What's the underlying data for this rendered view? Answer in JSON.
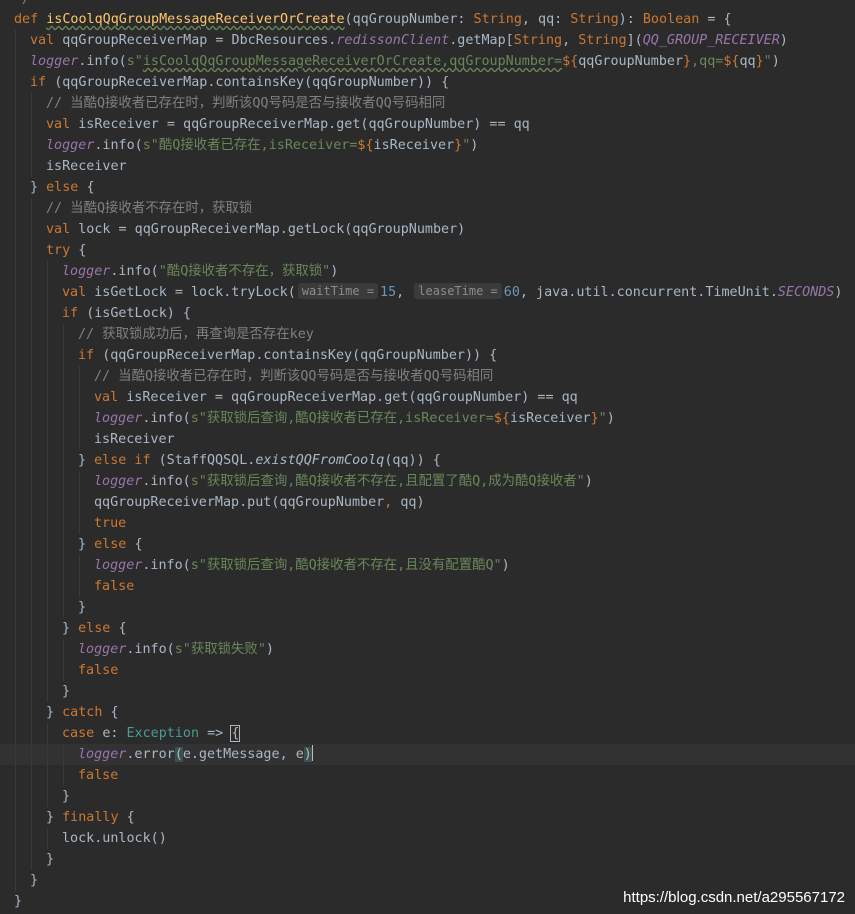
{
  "watermark": "https://blog.csdn.net/a295567172",
  "hints": {
    "waitTime": "waitTime =",
    "leaseTime": "leaseTime ="
  },
  "code": {
    "l1a": "def ",
    "l1b": "isCoolqQqGroupMessageReceiverOrCreate",
    "l1c": "(qqGroupNumber: ",
    "l1d": "String",
    ", ": "",
    "l1e": ", qq: ",
    "l1f": "String",
    "l1g": "): ",
    "l1h": "Boolean",
    "l1i": " = {",
    "l2a": "val ",
    "l2b": "qqGroupReceiverMap = DbcResources.",
    "l2c": "redissonClient",
    ".getMap": "",
    "l2d": ".getMap[",
    "l2e": "String",
    ", String": "",
    "l2f": ", ",
    "l2g": "String",
    "l2h": "](",
    "l2i": "QQ_GROUP_RECEIVER",
    "l2j": ")",
    "l3a": "logger",
    ".info": "",
    "l3b": ".info(",
    "l3c": "s\"",
    "l3d": "isCoolqQqGroupMessageReceiverOrCreate,qqGroupNumber=",
    "l3e": "${",
    "l3f": "qqGroupNumber",
    "l3g": "}",
    ",qq=": "",
    "l3h": ",qq=",
    "l3i": "${",
    "l3j": "qq",
    "l3k": "}",
    "l3l": "\"",
    ")": "",
    "l3m": ")",
    "l4a": "if ",
    "l4b": "(qqGroupReceiverMap.containsKey(qqGroupNumber)) {",
    "l5": "// 当酷Q接收者已存在时，判断该QQ号码是否与接收者QQ号码相同",
    "l6a": "val ",
    "l6b": "isReceiver = qqGroupReceiverMap.get(qqGroupNumber) == qq",
    "l7a": "logger",
    "l7b": ".info(",
    "l7c": "s\"酷Q接收者已存在,isReceiver=",
    "l7d": "${",
    "l7e": "isReceiver",
    "l7f": "}",
    "l7g": "\"",
    "l7h": ")",
    "l8": "isReceiver",
    "l9a": "} ",
    "l9b": "else ",
    "l9c": "{",
    "l10": "// 当酷Q接收者不存在时，获取锁",
    "l11a": "val ",
    "l11b": "lock = qqGroupReceiverMap.getLock(qqGroupNumber)",
    "l12a": "try ",
    "l12b": "{",
    "l13a": "logger",
    "l13b": ".info(",
    "l13c": "\"酷Q接收者不存在，获取锁\"",
    "l13d": ")",
    "l14a": "val ",
    "l14b": "isGetLock = lock.tryLock(",
    "l14c": "15",
    "l14d": ", ",
    "l14e": "60",
    ", java": "",
    "l14f": ", java.util.concurrent.TimeUnit.",
    "l14g": "SECONDS",
    "l14h": ")",
    "l15a": "if ",
    "l15b": "(isGetLock) {",
    "l16": "// 获取锁成功后，再查询是否存在key",
    "l17a": "if ",
    "l17b": "(qqGroupReceiverMap.containsKey(qqGroupNumber)) {",
    "l18": "// 当酷Q接收者已存在时，判断该QQ号码是否与接收者QQ号码相同",
    "l19a": "val ",
    "l19b": "isReceiver = qqGroupReceiverMap.get(qqGroupNumber) == qq",
    "l20a": "logger",
    "l20b": ".info(",
    "l20c": "s\"获取锁后查询,酷Q接收者已存在,isReceiver=",
    "l20d": "${",
    "l20e": "isReceiver",
    "l20f": "}",
    "l20g": "\"",
    "l20h": ")",
    "l21": "isReceiver",
    "l22a": "} ",
    "l22b": "else if ",
    "l22c": "(StaffQQSQL.",
    "l22d": "existQQFromCoolq",
    "l22e": "(qq)) {",
    "l23a": "logger",
    "l23b": ".info(",
    "l23c": "s\"获取锁后查询,酷Q接收者不存在,且配置了酷Q,成为酷Q接收者\"",
    "l23d": ")",
    "l24a": "qqGroupReceiverMap.put(qqGroupNumber",
    "l24b": ", ",
    "l24c": "qq)",
    "l25": "true",
    "l26a": "} ",
    "l26b": "else ",
    "l26c": "{",
    "l27a": "logger",
    "l27b": ".info(",
    "l27c": "s\"获取锁后查询,酷Q接收者不存在,且没有配置酷Q\"",
    "l27d": ")",
    "l28": "false",
    "l29": "}",
    "l30a": "} ",
    "l30b": "else ",
    "l30c": "{",
    "l31a": "logger",
    "l31b": ".info(",
    "l31c": "s\"获取锁失败\"",
    "l31d": ")",
    "l32": "false",
    "l33": "}",
    "l34a": "} ",
    "l34b": "catch ",
    "l34c": "{",
    "l35a": "case ",
    "l35b": "e: ",
    "l35c": "Exception",
    " => ": "",
    "l35d": " => ",
    "l35e": "{",
    "l36a": "logger",
    "l36b": ".error",
    "l36c": "(",
    "l36d": "e.getMessage",
    "l36e": ", ",
    "l36f": "e",
    "l36g": ")",
    "l37": "false",
    "l38": "}",
    "l39a": "} ",
    "l39b": "finally ",
    "l39c": "{",
    "l40": "lock.unlock()",
    "l41": "}",
    "l42": "}",
    "l43": "}"
  }
}
